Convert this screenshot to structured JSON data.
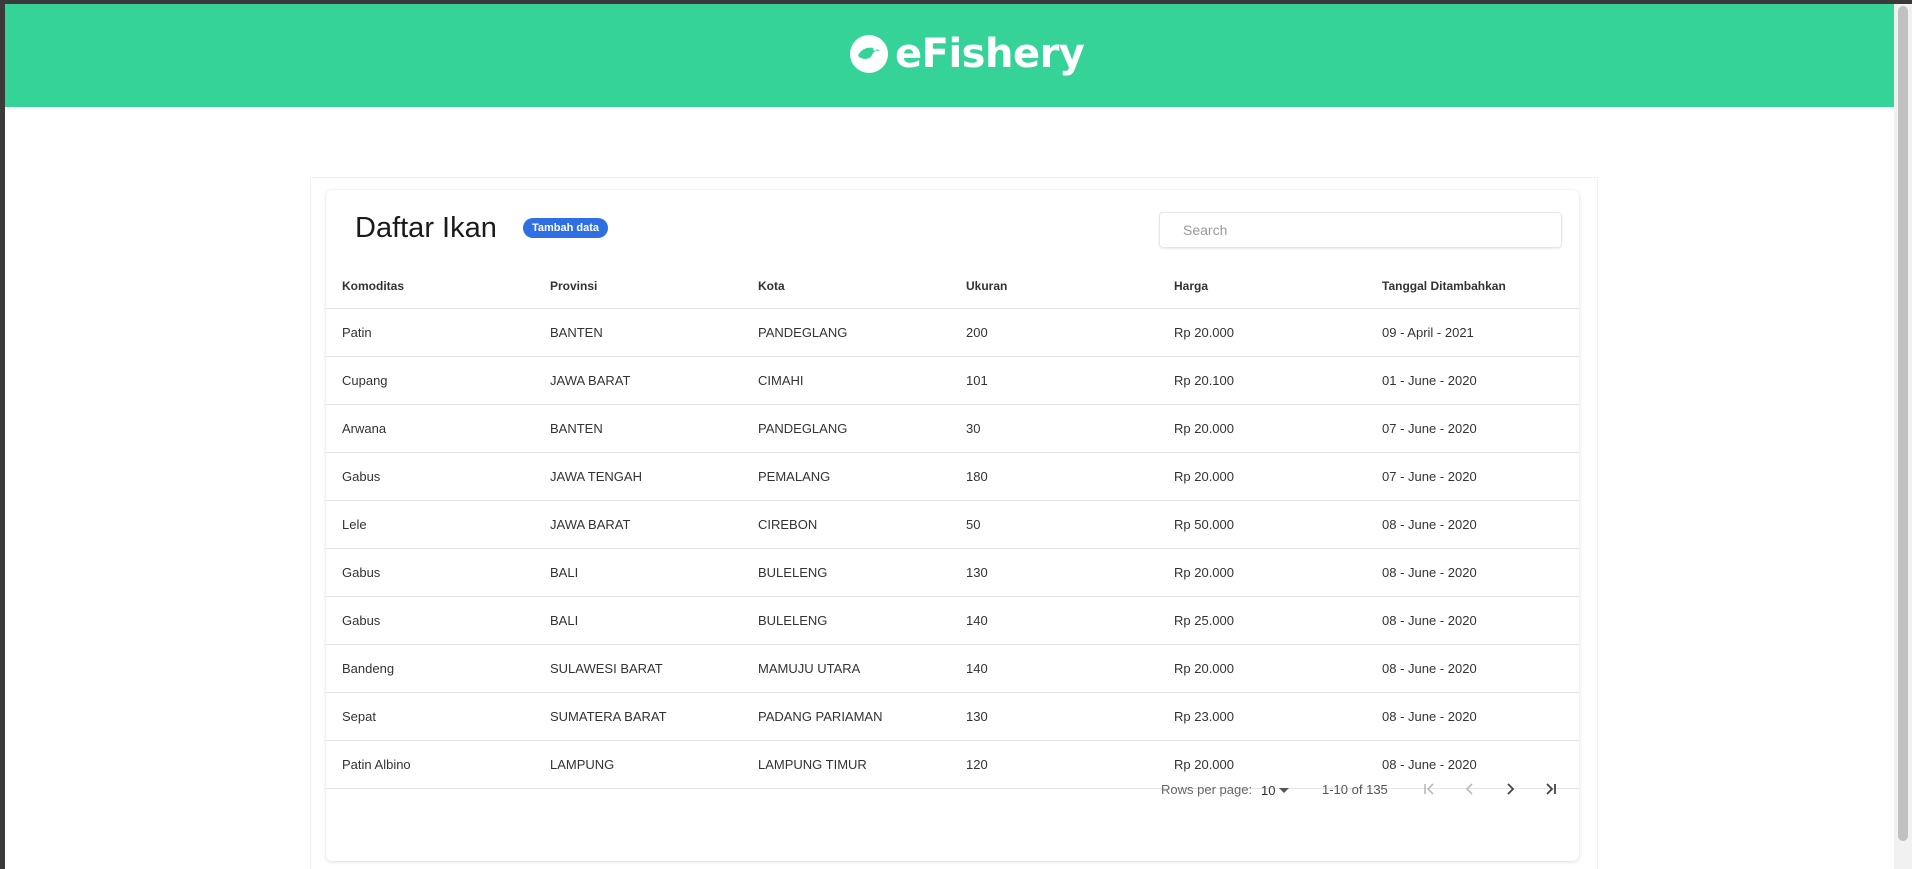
{
  "header": {
    "brand": "eFishery",
    "color": "#36d399"
  },
  "page": {
    "title": "Daftar Ikan",
    "add_button": "Tambah data",
    "search_placeholder": "Search"
  },
  "table": {
    "columns": [
      "Komoditas",
      "Provinsi",
      "Kota",
      "Ukuran",
      "Harga",
      "Tanggal Ditambahkan"
    ],
    "rows": [
      [
        "Patin",
        "BANTEN",
        "PANDEGLANG",
        "200",
        "Rp 20.000",
        "09 - April - 2021"
      ],
      [
        "Cupang",
        "JAWA BARAT",
        "CIMAHI",
        "101",
        "Rp 20.100",
        "01 - June - 2020"
      ],
      [
        "Arwana",
        "BANTEN",
        "PANDEGLANG",
        "30",
        "Rp 20.000",
        "07 - June - 2020"
      ],
      [
        "Gabus",
        "JAWA TENGAH",
        "PEMALANG",
        "180",
        "Rp 20.000",
        "07 - June - 2020"
      ],
      [
        "Lele",
        "JAWA BARAT",
        "CIREBON",
        "50",
        "Rp 50.000",
        "08 - June - 2020"
      ],
      [
        "Gabus",
        "BALI",
        "BULELENG",
        "130",
        "Rp 20.000",
        "08 - June - 2020"
      ],
      [
        "Gabus",
        "BALI",
        "BULELENG",
        "140",
        "Rp 25.000",
        "08 - June - 2020"
      ],
      [
        "Bandeng",
        "SULAWESI BARAT",
        "MAMUJU UTARA",
        "140",
        "Rp 20.000",
        "08 - June - 2020"
      ],
      [
        "Sepat",
        "SUMATERA BARAT",
        "PADANG PARIAMAN",
        "130",
        "Rp 23.000",
        "08 - June - 2020"
      ],
      [
        "Patin Albino",
        "LAMPUNG",
        "LAMPUNG TIMUR",
        "120",
        "Rp 20.000",
        "08 - June - 2020"
      ]
    ]
  },
  "pagination": {
    "rows_per_page_label": "Rows per page:",
    "rows_per_page": "10",
    "range": "1-10 of 135",
    "buttons": [
      "first-page-icon",
      "previous-page-icon",
      "next-page-icon",
      "last-page-icon"
    ]
  },
  "accent": {
    "button": "#2f6fe4"
  }
}
